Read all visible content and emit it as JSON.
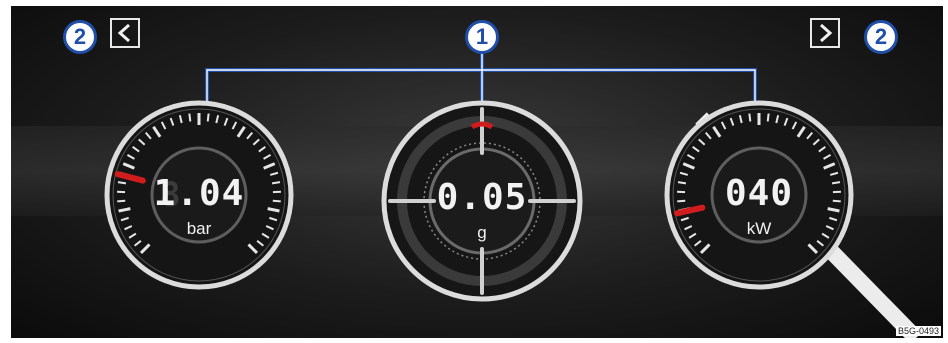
{
  "callouts": {
    "center": "1",
    "left": "2",
    "right": "2"
  },
  "nav": {
    "prev_icon": "chevron-left-icon",
    "next_icon": "chevron-right-icon"
  },
  "gauges": [
    {
      "id": "boost-pressure",
      "value": "1.04",
      "unit": "bar",
      "level": 0.22
    },
    {
      "id": "g-force",
      "value": "0.05",
      "unit": "g"
    },
    {
      "id": "power",
      "value": "040",
      "unit": "kW",
      "level": 0.12
    }
  ],
  "colors": {
    "callout_blue": "#1f4fa8",
    "needle_red": "#d01c1c",
    "ring_silver": "#d8d8d8",
    "background": "#1c1c1c"
  },
  "reference_code": "B5G-0493"
}
